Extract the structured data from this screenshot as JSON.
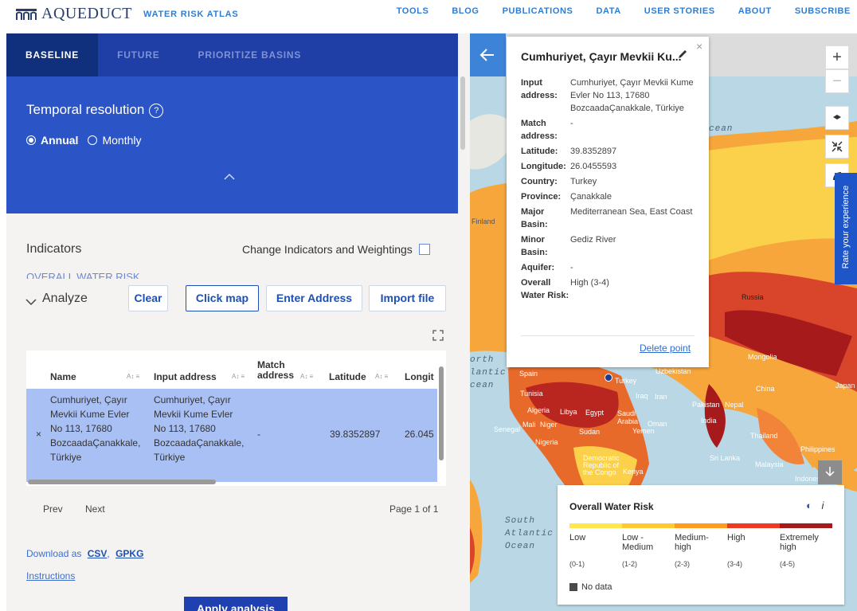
{
  "brand": {
    "name": "AQUEDUCT",
    "subtitle": "WATER RISK ATLAS"
  },
  "nav": [
    "TOOLS",
    "BLOG",
    "PUBLICATIONS",
    "DATA",
    "USER STORIES",
    "ABOUT",
    "SUBSCRIBE"
  ],
  "tabs": [
    "BASELINE",
    "FUTURE",
    "PRIORITIZE BASINS"
  ],
  "temporal": {
    "title": "Temporal resolution",
    "help": "?",
    "options": [
      "Annual",
      "Monthly"
    ],
    "selected": "Annual"
  },
  "indicators": {
    "title": "Indicators",
    "change_label": "Change Indicators and Weightings",
    "overall_peek": "OVERALL WATER RISK"
  },
  "analyze": {
    "title": "Analyze",
    "buttons": {
      "clear": "Clear",
      "click_map": "Click map",
      "enter_address": "Enter Address",
      "import_file": "Import file"
    },
    "columns": [
      "Name",
      "Input address",
      "Match address",
      "Latitude",
      "Longit"
    ],
    "row": {
      "remove": "×",
      "name": [
        "Cumhuriyet, Çayır",
        "Mevkii Kume Evler",
        "No 113, 17680",
        "BozcaadaÇanakkale,",
        "Türkiye"
      ],
      "input_address": [
        "Cumhuriyet, Çayır",
        "Mevkii Kume Evler",
        "No 113, 17680",
        "BozcaadaÇanakkale,",
        "Türkiye"
      ],
      "match_address": "-",
      "latitude": "39.8352897",
      "longitude": "26.045"
    },
    "pager": {
      "prev": "Prev",
      "next": "Next",
      "page": "Page 1 of 1"
    },
    "download": {
      "label": "Download as",
      "csv": "CSV",
      "gpkg": "GPKG"
    },
    "instructions": "Instructions",
    "apply": "Apply analysis"
  },
  "map": {
    "back_icon": "arrow-left-icon",
    "zoom_in": "+",
    "zoom_out": "−",
    "rate": "Rate your experience",
    "labels": [
      "Finland",
      "Russia",
      "Mongolia",
      "Uzbekistan",
      "China",
      "Japan",
      "Turkey",
      "Spain",
      "Tunisia",
      "Iraq",
      "Iran",
      "Pakistan",
      "Nepal",
      "Algeria",
      "Libya",
      "Egypt",
      "Saudi Arabia",
      "Oman",
      "India",
      "Senegal",
      "Mali",
      "Niger",
      "Sudan",
      "Yemen",
      "Nigeria",
      "Thailand",
      "Philippines",
      "Sri Lanka",
      "Malaysia",
      "Indonesia",
      "Democratic Republic of the Congo",
      "Kenya"
    ],
    "ocean_south_atlantic": [
      "South",
      "Atlantic",
      "Ocean"
    ],
    "ocean_north": [
      "orth",
      "lantic",
      "cean"
    ],
    "ocean_arctic": "cean"
  },
  "popup": {
    "title": "Cumhuriyet, Çayır Mevkii Ku...",
    "close": "×",
    "fields": [
      {
        "key": "Input address:",
        "value": "Cumhuriyet, Çayır Mevkii Kume Evler No 113, 17680 BozcaadaÇanakkale, Türkiye"
      },
      {
        "key": "Match address:",
        "value": "-"
      },
      {
        "key": "Latitude:",
        "value": "39.8352897"
      },
      {
        "key": "Longitude:",
        "value": "26.0455593"
      },
      {
        "key": "Country:",
        "value": "Turkey"
      },
      {
        "key": "Province:",
        "value": "Çanakkale"
      },
      {
        "key": "Major Basin:",
        "value": "Mediterranean Sea, East Coast"
      },
      {
        "key": "Minor Basin:",
        "value": "Gediz River"
      },
      {
        "key": "Aquifer:",
        "value": "-"
      },
      {
        "key": "Overall Water Risk:",
        "value": "High (3-4)"
      }
    ],
    "delete": "Delete point"
  },
  "legend": {
    "title": "Overall Water Risk",
    "info": "i",
    "classes": [
      {
        "label": "Low",
        "range": "(0-1)",
        "color": "#ffe74d"
      },
      {
        "label": "Low - Medium",
        "range": "(1-2)",
        "color": "#ffca2f"
      },
      {
        "label": "Medium- high",
        "range": "(2-3)",
        "color": "#ff9b1e"
      },
      {
        "label": "High",
        "range": "(3-4)",
        "color": "#ee3a23"
      },
      {
        "label": "Extremely high",
        "range": "(4-5)",
        "color": "#a71a1c"
      }
    ],
    "no_data": "No data"
  },
  "colors": {
    "nav_blue": "#2e7dd4",
    "tab_bg": "#1f3fa6",
    "panel_blue": "#2b55c7",
    "row_highlight": "#a9c0f5",
    "apply_bg": "#1e40b0"
  }
}
